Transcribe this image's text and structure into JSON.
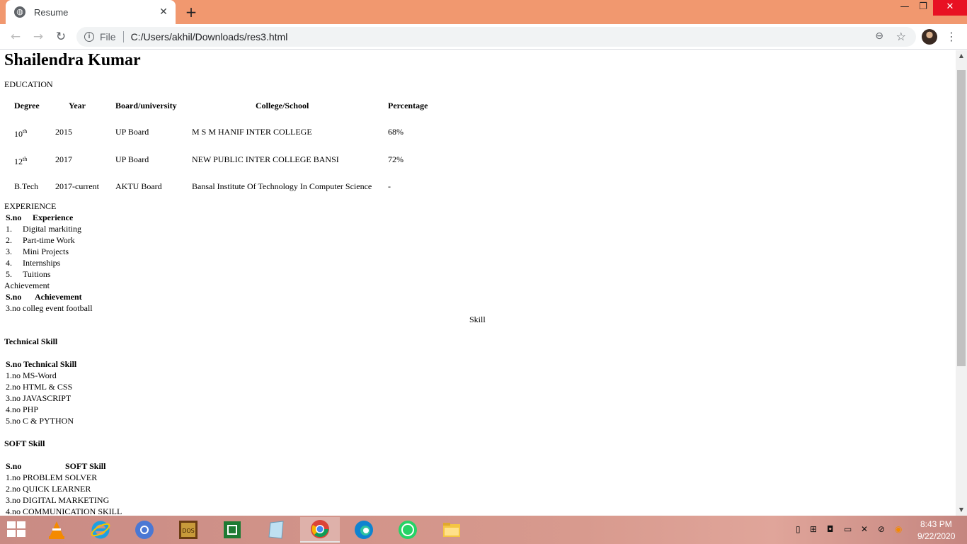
{
  "browser": {
    "tab_title": "Resume",
    "close_glyph": "✕",
    "new_tab_glyph": "+",
    "url_scheme": "File",
    "url": "C:/Users/akhil/Downloads/res3.html",
    "window_min": "—",
    "window_max": "❐",
    "window_close": "✕"
  },
  "resume": {
    "name": "Shailendra Kumar",
    "education": {
      "heading": "EDUCATION",
      "headers": [
        "Degree",
        "Year",
        "Board/university",
        "College/School",
        "Percentage"
      ],
      "rows": [
        {
          "degree": "10",
          "sup": "th",
          "year": "2015",
          "board": "UP Board",
          "college": "M S M HANIF INTER COLLEGE",
          "percentage": "68%"
        },
        {
          "degree": "12",
          "sup": "th",
          "year": "2017",
          "board": "UP Board",
          "college": "NEW PUBLIC INTER COLLEGE BANSI",
          "percentage": "72%"
        },
        {
          "degree": "B.Tech",
          "sup": "",
          "year": "2017-current",
          "board": "AKTU Board",
          "college": "Bansal Institute Of Technology In Computer Science",
          "percentage": "-"
        }
      ]
    },
    "experience": {
      "heading": "EXPERIENCE",
      "headers": [
        "S.no",
        "Experience"
      ],
      "rows": [
        {
          "sno": "1.",
          "item": "Digital markiting"
        },
        {
          "sno": "2.",
          "item": "Part-time Work"
        },
        {
          "sno": "3.",
          "item": "Mini Projects"
        },
        {
          "sno": "4.",
          "item": "Internships"
        },
        {
          "sno": "5.",
          "item": "Tuitions"
        }
      ]
    },
    "achievement": {
      "heading": "Achievement",
      "headers": [
        "S.no",
        "Achievement"
      ],
      "rows": [
        {
          "sno": "3.no",
          "item": "colleg event football"
        }
      ]
    },
    "skill_heading": "Skill",
    "technical": {
      "heading": "Technical Skill",
      "headers": [
        "S.no",
        "Technical Skill"
      ],
      "rows": [
        {
          "sno": "1.no",
          "item": "MS-Word"
        },
        {
          "sno": "2.no",
          "item": "HTML & CSS"
        },
        {
          "sno": "3.no",
          "item": "JAVASCRIPT"
        },
        {
          "sno": "4.no",
          "item": "PHP"
        },
        {
          "sno": "5.no",
          "item": "C & PYTHON"
        }
      ]
    },
    "soft": {
      "heading": "SOFT Skill",
      "headers": [
        "S.no",
        "SOFT Skill"
      ],
      "rows": [
        {
          "sno": "1.no",
          "item": "PROBLEM SOLVER"
        },
        {
          "sno": "2.no",
          "item": "QUICK LEARNER"
        },
        {
          "sno": "3.no",
          "item": "DIGITAL MARKETING"
        },
        {
          "sno": "4.no",
          "item": "COMMUNICATION SKILL"
        }
      ]
    }
  },
  "taskbar": {
    "time": "8:43 PM",
    "date": "9/22/2020",
    "apps": [
      "start",
      "vlc",
      "internet-explorer",
      "chromium",
      "dosbox",
      "excel",
      "notepad",
      "chrome",
      "edge",
      "whatsapp",
      "file-explorer"
    ],
    "active_app": "chrome"
  }
}
